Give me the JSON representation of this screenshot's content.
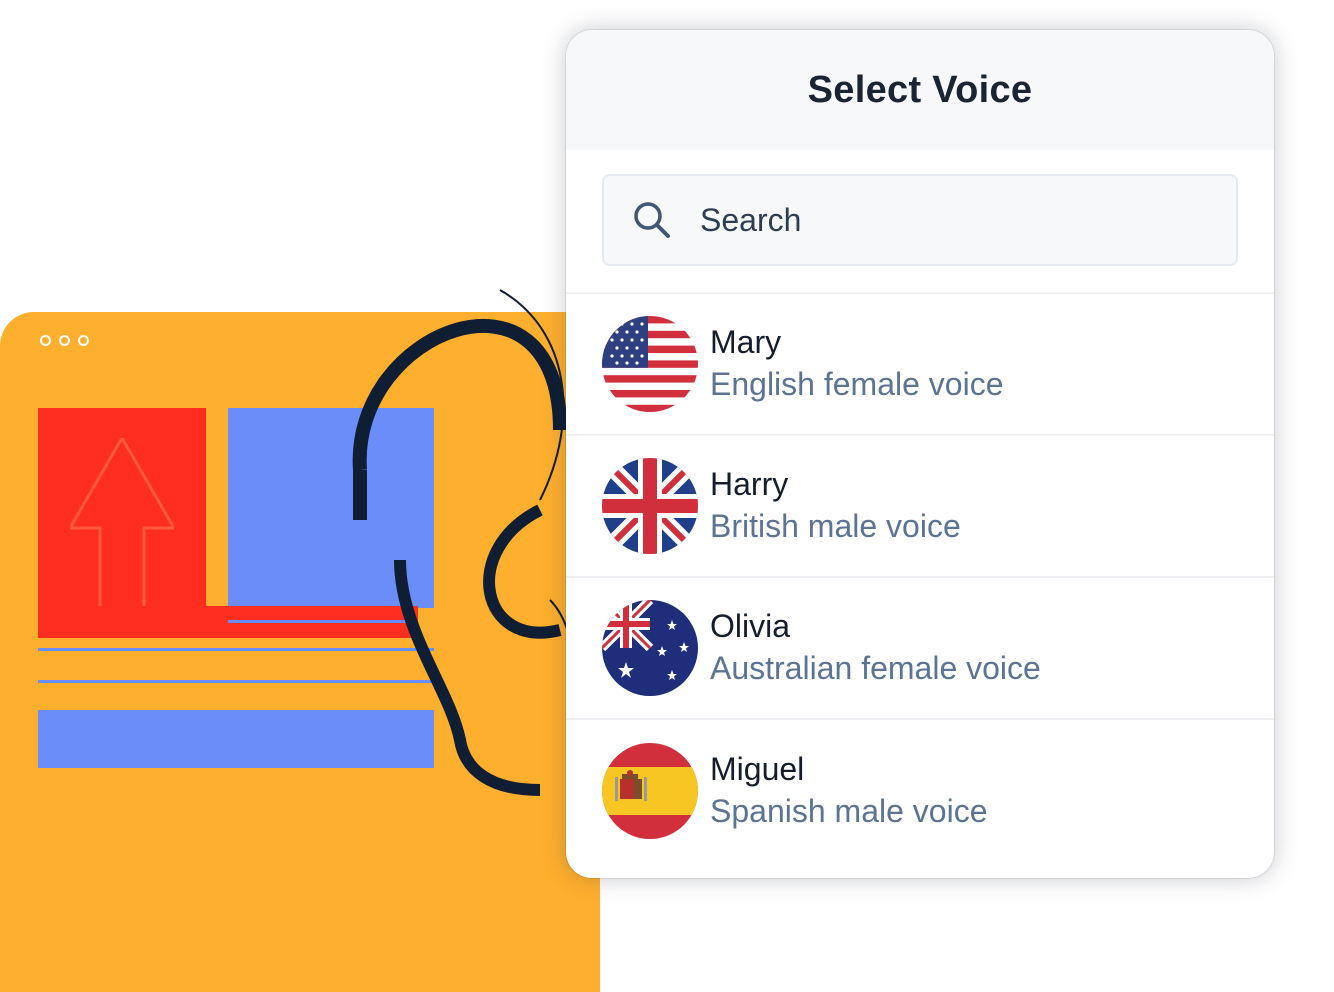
{
  "dialog": {
    "title": "Select Voice",
    "search": {
      "placeholder": "Search",
      "value": ""
    },
    "voices": [
      {
        "name": "Mary",
        "description": "English female voice",
        "flag_icon": "us-flag-icon"
      },
      {
        "name": "Harry",
        "description": "British male voice",
        "flag_icon": "uk-flag-icon"
      },
      {
        "name": "Olivia",
        "description": "Australian female voice",
        "flag_icon": "australia-flag-icon"
      },
      {
        "name": "Miguel",
        "description": "Spanish male voice",
        "flag_icon": "spain-flag-icon"
      }
    ]
  },
  "colors": {
    "illustration_orange": "#FFAF2E",
    "illustration_red": "#FF2E1F",
    "illustration_blue": "#6A8DF9",
    "title_text": "#1A2433",
    "secondary_text": "#5B7394"
  }
}
